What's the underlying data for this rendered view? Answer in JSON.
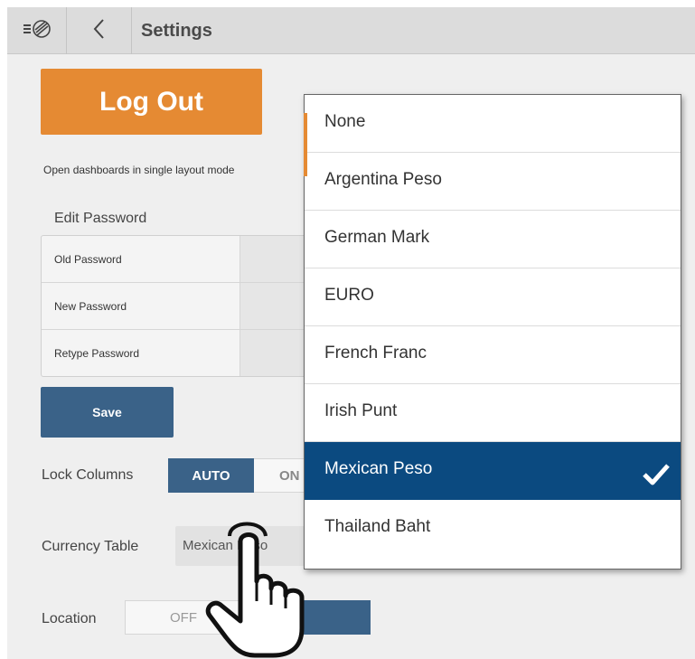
{
  "header": {
    "title": "Settings",
    "menu_icon": "menu-logo-icon",
    "back_icon": "chevron-left-icon"
  },
  "settings": {
    "logout_label": "Log Out",
    "single_layout_text": "Open dashboards in single layout mode",
    "edit_password": {
      "title": "Edit Password",
      "old_label": "Old Password",
      "new_label": "New Password",
      "retype_label": "Retype Password"
    },
    "save_label": "Save",
    "lock_columns": {
      "label": "Lock Columns",
      "auto": "AUTO",
      "on": "ON",
      "selected": "AUTO"
    },
    "currency_table": {
      "label": "Currency Table",
      "value": "Mexican Peso"
    },
    "location": {
      "label": "Location",
      "off": "OFF"
    }
  },
  "dropdown": {
    "options": [
      "None",
      "Argentina Peso",
      "German Mark",
      "EURO",
      "French Franc",
      "Irish Punt",
      "Mexican Peso",
      "Thailand Baht"
    ],
    "selected": "Mexican Peso",
    "check_icon": "checkmark-icon"
  },
  "colors": {
    "accent_orange": "#e58a33",
    "primary_blue": "#3a6288",
    "selected_blue": "#0b4a80",
    "header_gray": "#dcdcdc",
    "panel_gray": "#efefef"
  },
  "pointer_icon": "hand-pointer-icon"
}
